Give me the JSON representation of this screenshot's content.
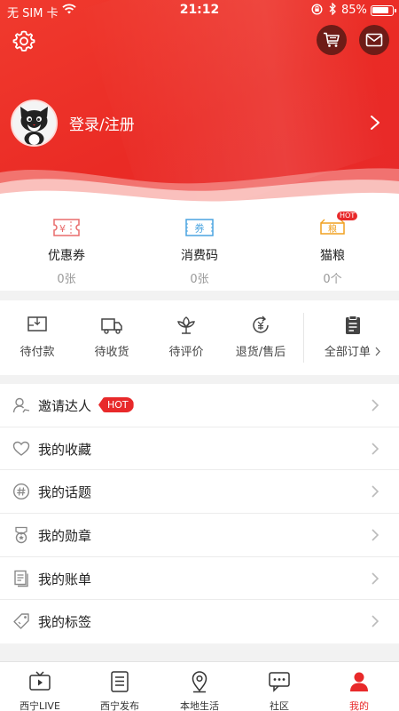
{
  "status_bar": {
    "carrier": "无 SIM 卡",
    "time": "21:12",
    "battery_text": "85%",
    "battery_level": 0.85
  },
  "header": {
    "settings_icon": "gear-icon",
    "cart_icon": "cart-icon",
    "mail_icon": "envelope-icon",
    "login_label": "登录/注册",
    "accent_color": "#e8292a"
  },
  "coupons": [
    {
      "name": "优惠券",
      "value": "0张",
      "icon": "yen-ticket-icon"
    },
    {
      "name": "消费码",
      "value": "0张",
      "icon": "voucher-icon",
      "icon_text": "券"
    },
    {
      "name": "猫粮",
      "value": "0个",
      "icon": "cat-food-icon",
      "icon_text": "粮",
      "badge": "HOT"
    }
  ],
  "orders": {
    "items": [
      {
        "label": "待付款",
        "icon": "wallet-icon"
      },
      {
        "label": "待收货",
        "icon": "truck-icon"
      },
      {
        "label": "待评价",
        "icon": "flower-icon"
      },
      {
        "label": "退货/售后",
        "icon": "refund-icon"
      }
    ],
    "all_label": "全部订单",
    "all_icon": "clipboard-icon"
  },
  "menu": [
    {
      "label": "邀请达人",
      "icon": "invite-user-icon",
      "badge": "HOT"
    },
    {
      "label": "我的收藏",
      "icon": "heart-icon"
    },
    {
      "label": "我的话题",
      "icon": "hashtag-icon"
    },
    {
      "label": "我的勋章",
      "icon": "medal-icon"
    },
    {
      "label": "我的账单",
      "icon": "bill-icon"
    },
    {
      "label": "我的标签",
      "icon": "tag-icon"
    }
  ],
  "tabs": [
    {
      "label": "西宁LIVE",
      "icon": "tv-icon",
      "active": false
    },
    {
      "label": "西宁发布",
      "icon": "list-icon",
      "active": false
    },
    {
      "label": "本地生活",
      "icon": "location-pin-icon",
      "active": false
    },
    {
      "label": "社区",
      "icon": "chat-icon",
      "active": false
    },
    {
      "label": "我的",
      "icon": "person-icon",
      "active": true
    }
  ]
}
